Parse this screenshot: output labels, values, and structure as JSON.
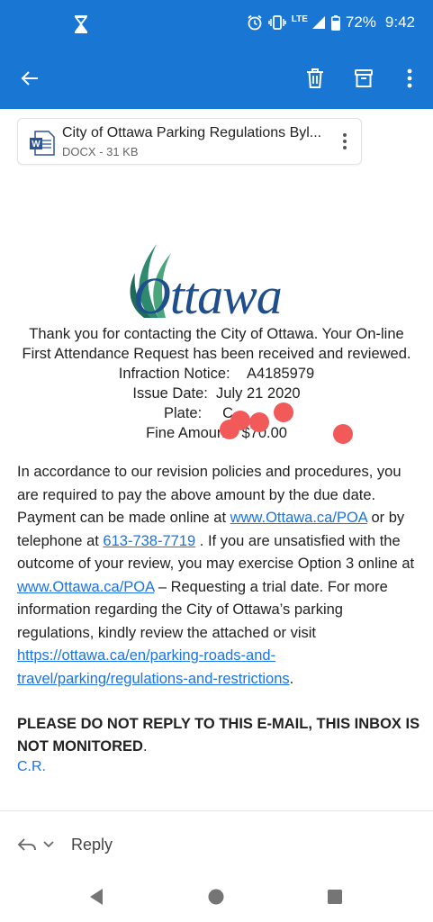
{
  "status_bar": {
    "lte": "LTE",
    "battery": "72%",
    "time": "9:42"
  },
  "app_bar": {
    "back_icon": "arrow-left-icon",
    "delete_icon": "trash-icon",
    "archive_icon": "archive-icon",
    "more_icon": "more-vert-icon"
  },
  "attachment": {
    "name": "City of Ottawa Parking Regulations Byl...",
    "meta": "DOCX - 31 KB"
  },
  "logo": {
    "text": "Ottawa"
  },
  "email": {
    "intro_line1": "Thank you for contacting the City of Ottawa.  Your On-line",
    "intro_line2": "First Attendance Request has been received and reviewed.",
    "infraction_label": "Infraction Notice:",
    "infraction_value": "A4185979",
    "issue_label": "Issue Date:",
    "issue_value": "July 21 2020",
    "plate_label": "Plate:",
    "plate_value": "C",
    "fine_label": "Fine Amount:",
    "fine_value": "$70.00",
    "para_1": "In accordance to our revision policies and procedures, you are required to pay the above amount by the due date. Payment can be made online at ",
    "link_poa_1": "www.Ottawa.ca/POA",
    "para_2": " or by telephone at ",
    "link_phone": "613-738-7719",
    "para_3": " . If you are unsatisfied with the outcome of your review, you may exercise Option 3 online at ",
    "link_poa_2": "www.Ottawa.ca/POA",
    "para_4": " – Requesting a trial date. For more information regarding the City of Ottawa’s parking regulations, kindly review the attached or visit ",
    "link_regs": "https://ottawa.ca/en/parking-roads-and-travel/parking/regulations-and-restrictions",
    "para_5": ".",
    "warning": "PLEASE DO NOT REPLY TO THIS E-MAIL, THIS INBOX IS NOT MONITORED",
    "warning_period": ".",
    "signature": "C.R."
  },
  "reply": {
    "label": "Reply"
  },
  "colors": {
    "app_bar": "#1976d2",
    "link": "#1a73e8",
    "redaction": "#f25a5a"
  }
}
